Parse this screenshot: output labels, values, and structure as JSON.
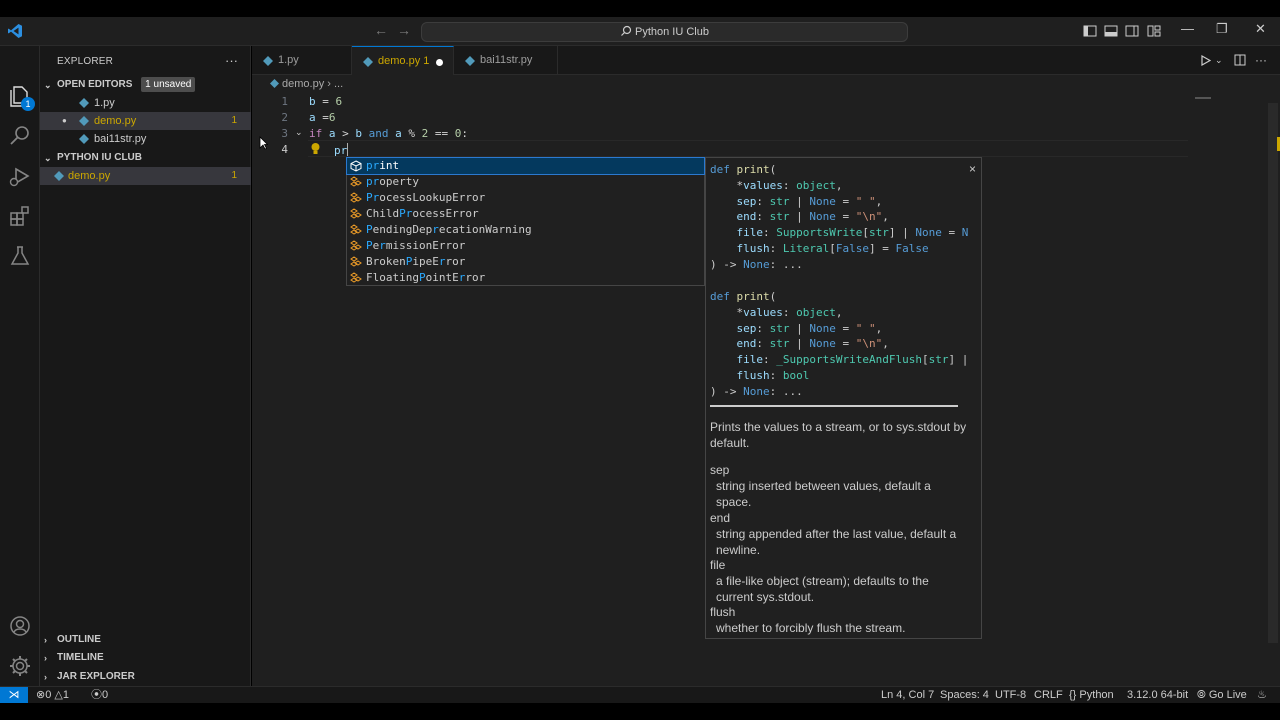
{
  "window": {
    "title": "Python IU Club",
    "nav_back": "←",
    "nav_forward": "→",
    "min": "—",
    "restore": "❐",
    "close": "✕"
  },
  "activity_bar": {
    "explorer_badge": "1"
  },
  "sidebar": {
    "header": "EXPLORER",
    "more": "···",
    "open_editors": {
      "title": "OPEN EDITORS",
      "unsaved": "1 unsaved",
      "files": [
        {
          "name": "1.py",
          "errors": ""
        },
        {
          "name": "demo.py",
          "errors": "1"
        },
        {
          "name": "bai11str.py",
          "errors": ""
        }
      ]
    },
    "workspace": {
      "title": "PYTHON IU CLUB",
      "files": [
        {
          "name": "demo.py",
          "errors": "1"
        }
      ]
    },
    "bottom_sections": [
      "OUTLINE",
      "TIMELINE",
      "JAR EXPLORER"
    ]
  },
  "tabs": [
    {
      "label": "1.py"
    },
    {
      "label": "demo.py 1"
    },
    {
      "label": "bai11str.py"
    }
  ],
  "breadcrumb": {
    "file": "demo.py",
    "sep": "›",
    "rest": "..."
  },
  "editor": {
    "line_numbers": [
      "1",
      "2",
      "3",
      "4"
    ],
    "lines": {
      "l1": {
        "var": "b",
        "op": " = ",
        "num": "6"
      },
      "l2": {
        "var": "a",
        "op": " =",
        "num": "6"
      },
      "l3": {
        "kw": "if",
        "a": "a",
        "gt": " > ",
        "b": "b",
        "and": " and ",
        "a2": "a",
        "mod": " % ",
        "two": "2",
        "eq": " == ",
        "zero": "0",
        "colon": ":"
      },
      "l4": {
        "typed": "pr"
      }
    }
  },
  "suggestions": [
    {
      "match": "pr",
      "rest": "int",
      "kind": "function"
    },
    {
      "match": "pr",
      "rest": "operty",
      "kind": "class"
    },
    {
      "pre": "",
      "match": "Pr",
      "rest": "ocessLookupError",
      "kind": "class"
    },
    {
      "pre": "Child",
      "match": "Pr",
      "rest": "ocessError",
      "kind": "class"
    },
    {
      "pre": "",
      "match": "P",
      "mid": "endingDep",
      "match2": "r",
      "rest": "ecationWarning",
      "kind": "class"
    },
    {
      "pre": "",
      "match": "P",
      "mid": "e",
      "match2": "r",
      "rest": "missionError",
      "kind": "class"
    },
    {
      "pre": "Broken",
      "match": "P",
      "mid": "ipeE",
      "match2": "r",
      "rest": "ror",
      "kind": "class"
    },
    {
      "pre": "Floating",
      "match": "P",
      "mid": "ointE",
      "match2": "r",
      "rest": "ror",
      "kind": "class"
    }
  ],
  "details": {
    "close": "×",
    "doc_intro": "Prints the values to a stream, or to sys.stdout by default.",
    "params": [
      {
        "name": "sep",
        "desc": "string inserted between values, default a space."
      },
      {
        "name": "end",
        "desc": "string appended after the last value, default a newline."
      },
      {
        "name": "file",
        "desc": "a file-like object (stream); defaults to the current sys.stdout."
      },
      {
        "name": "flush",
        "desc": "whether to forcibly flush the stream."
      }
    ]
  },
  "status": {
    "remote": "⋊",
    "errors": "0",
    "warnings": "1",
    "ports": "0",
    "position": "Ln 4, Col 7",
    "spaces": "Spaces: 4",
    "encoding": "UTF-8",
    "eol": "CRLF",
    "language": "Python",
    "interpreter": "3.12.0 64-bit",
    "go_live": "Go Live"
  },
  "colors": {
    "accent": "#0078d4",
    "modified": "#cca700",
    "background": "#1f1f1f"
  }
}
